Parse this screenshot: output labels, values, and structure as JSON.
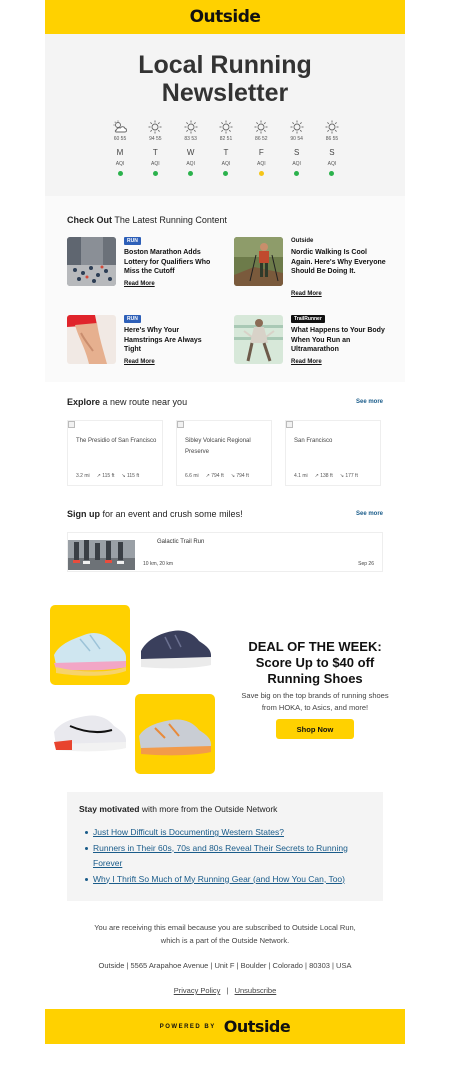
{
  "brand": {
    "logo": "Outside",
    "yellow": "#FFD100",
    "link_color": "#1a5c8a"
  },
  "hero": {
    "title_line1": "Local Running",
    "title_line2": "Newsletter",
    "weather": [
      {
        "icon": "partly-cloudy-icon",
        "temps": "60  55",
        "day": "M",
        "aqi": "AQI",
        "aqi_color": "#2bb24c"
      },
      {
        "icon": "sun-icon",
        "temps": "94  55",
        "day": "T",
        "aqi": "AQI",
        "aqi_color": "#2bb24c"
      },
      {
        "icon": "sun-icon",
        "temps": "83  53",
        "day": "W",
        "aqi": "AQI",
        "aqi_color": "#2bb24c"
      },
      {
        "icon": "sun-icon",
        "temps": "82  51",
        "day": "T",
        "aqi": "AQI",
        "aqi_color": "#2bb24c"
      },
      {
        "icon": "sun-icon",
        "temps": "86  52",
        "day": "F",
        "aqi": "AQI",
        "aqi_color": "#f5c518"
      },
      {
        "icon": "sun-icon",
        "temps": "90  54",
        "day": "S",
        "aqi": "AQI",
        "aqi_color": "#2bb24c"
      },
      {
        "icon": "sun-icon",
        "temps": "86  55",
        "day": "S",
        "aqi": "AQI",
        "aqi_color": "#2bb24c"
      }
    ]
  },
  "content": {
    "title_bold": "Check Out",
    "title_rest": " The Latest Running Content",
    "articles": [
      {
        "badge": "RUN",
        "title": "Boston Marathon Adds Lottery for Qualifiers Who Miss the Cutoff",
        "read": "Read More"
      },
      {
        "badge": "Outside",
        "title": "Nordic Walking Is Cool Again. Here's Why Everyone Should Be Doing It.",
        "read": "Read More"
      },
      {
        "badge": "RUN",
        "title": "Here's Why Your Hamstrings Are Always Tight",
        "read": "Read More"
      },
      {
        "badge": "TrailRunner",
        "title": "What Happens to Your Body When You Run an Ultramarathon",
        "read": "Read More"
      }
    ]
  },
  "explore": {
    "title_bold": "Explore",
    "title_rest": " a new route near you",
    "see_more": "See more",
    "routes": [
      {
        "name": "The Presidio of San Francisco",
        "dist": "3.2 mi",
        "up": "115 ft",
        "down": "115 ft"
      },
      {
        "name": "Sibley Volcanic Regional Preserve",
        "dist": "6.6 mi",
        "up": "794 ft",
        "down": "794 ft"
      },
      {
        "name": "San Francisco",
        "dist": "4.1 mi",
        "up": "138 ft",
        "down": "177 ft"
      }
    ]
  },
  "signup": {
    "title_bold": "Sign up",
    "title_rest": " for an event and crush some miles!",
    "see_more": "See more",
    "event": {
      "name": "Galactic Trail Run",
      "distances": "10 km, 20 km",
      "date": "Sep 26"
    }
  },
  "deal": {
    "headline_line1": "DEAL OF THE WEEK:",
    "headline_line2": "Score Up to $40 off",
    "headline_line3": "Running Shoes",
    "subtext": "Save big on the top brands of running shoes from HOKA, to Asics, and more!",
    "cta": "Shop Now"
  },
  "motivated": {
    "title_bold": "Stay motivated",
    "title_rest": " with more from the Outside Network",
    "links": [
      "Just How Difficult is Documenting Western States?",
      "Runners in Their 60s, 70s and 80s Reveal Their Secrets to Running Forever",
      "Why I Thrift So Much of My Running Gear (and How You Can, Too)"
    ]
  },
  "footer": {
    "notice_line1": "You are receiving this email because you are subscribed to Outside Local Run,",
    "notice_line2": "which is a part of the Outside Network.",
    "address": "Outside | 5565 Arapahoe Avenue | Unit F | Boulder | Colorado | 80303 | USA",
    "privacy": "Privacy Policy",
    "separator": "|",
    "unsubscribe": "Unsubscribe",
    "powered_by": "POWERED BY",
    "logo": "Outside"
  }
}
